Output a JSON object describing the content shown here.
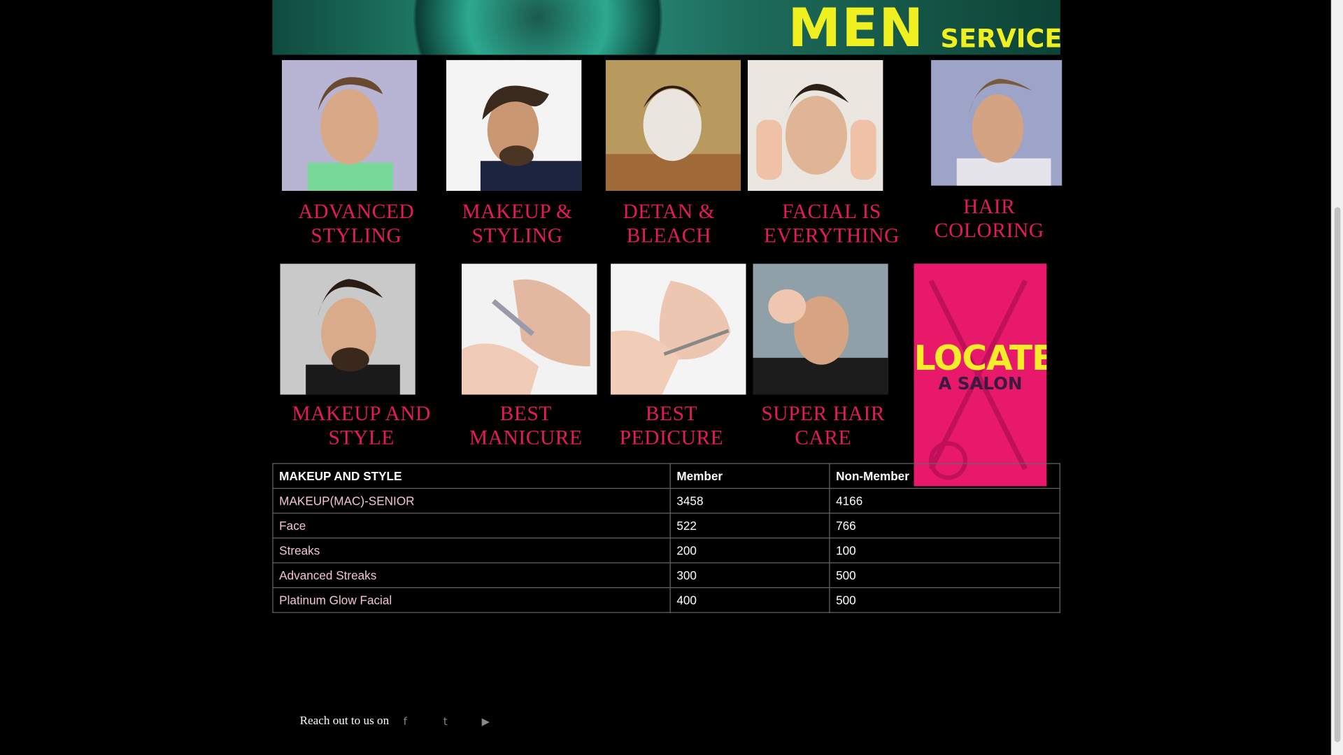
{
  "banner": {
    "men": "MEN",
    "services": "SERVICES"
  },
  "services_row1": [
    {
      "label_line1": "ADVANCED",
      "label_line2": "STYLING"
    },
    {
      "label_line1": "MAKEUP &",
      "label_line2": "STYLING"
    },
    {
      "label_line1": "DETAN &",
      "label_line2": "BLEACH"
    },
    {
      "label_line1": "FACIAL IS",
      "label_line2": "EVERYTHING"
    },
    {
      "label_line1": "HAIR",
      "label_line2": "COLORING"
    }
  ],
  "services_row2": [
    {
      "label_line1": "MAKEUP AND",
      "label_line2": "STYLE"
    },
    {
      "label_line1": "BEST",
      "label_line2": "MANICURE"
    },
    {
      "label_line1": "BEST",
      "label_line2": "PEDICURE"
    },
    {
      "label_line1": "SUPER HAIR",
      "label_line2": "CARE"
    }
  ],
  "locate": {
    "big": "LOCATE",
    "small": "A SALON"
  },
  "price_table": {
    "headers": [
      "MAKEUP AND STYLE",
      "Member",
      "Non-Member"
    ],
    "rows": [
      [
        "MAKEUP(MAC)-SENIOR",
        "3458",
        "4166"
      ],
      [
        "Face",
        "522",
        "766"
      ],
      [
        "Streaks",
        "200",
        "100"
      ],
      [
        "Advanced Streaks",
        "300",
        "500"
      ],
      [
        "Platinum Glow Facial",
        "400",
        "500"
      ]
    ]
  },
  "footer": {
    "reach_text": "Reach out to us on",
    "facebook_icon": "f",
    "twitter_icon": "t",
    "youtube_icon": "▶"
  },
  "colors": {
    "label_pink": "#e8185f",
    "locate_bg": "#e8196a",
    "locate_text": "#f6ec2a",
    "banner_text": "#f0f020"
  }
}
